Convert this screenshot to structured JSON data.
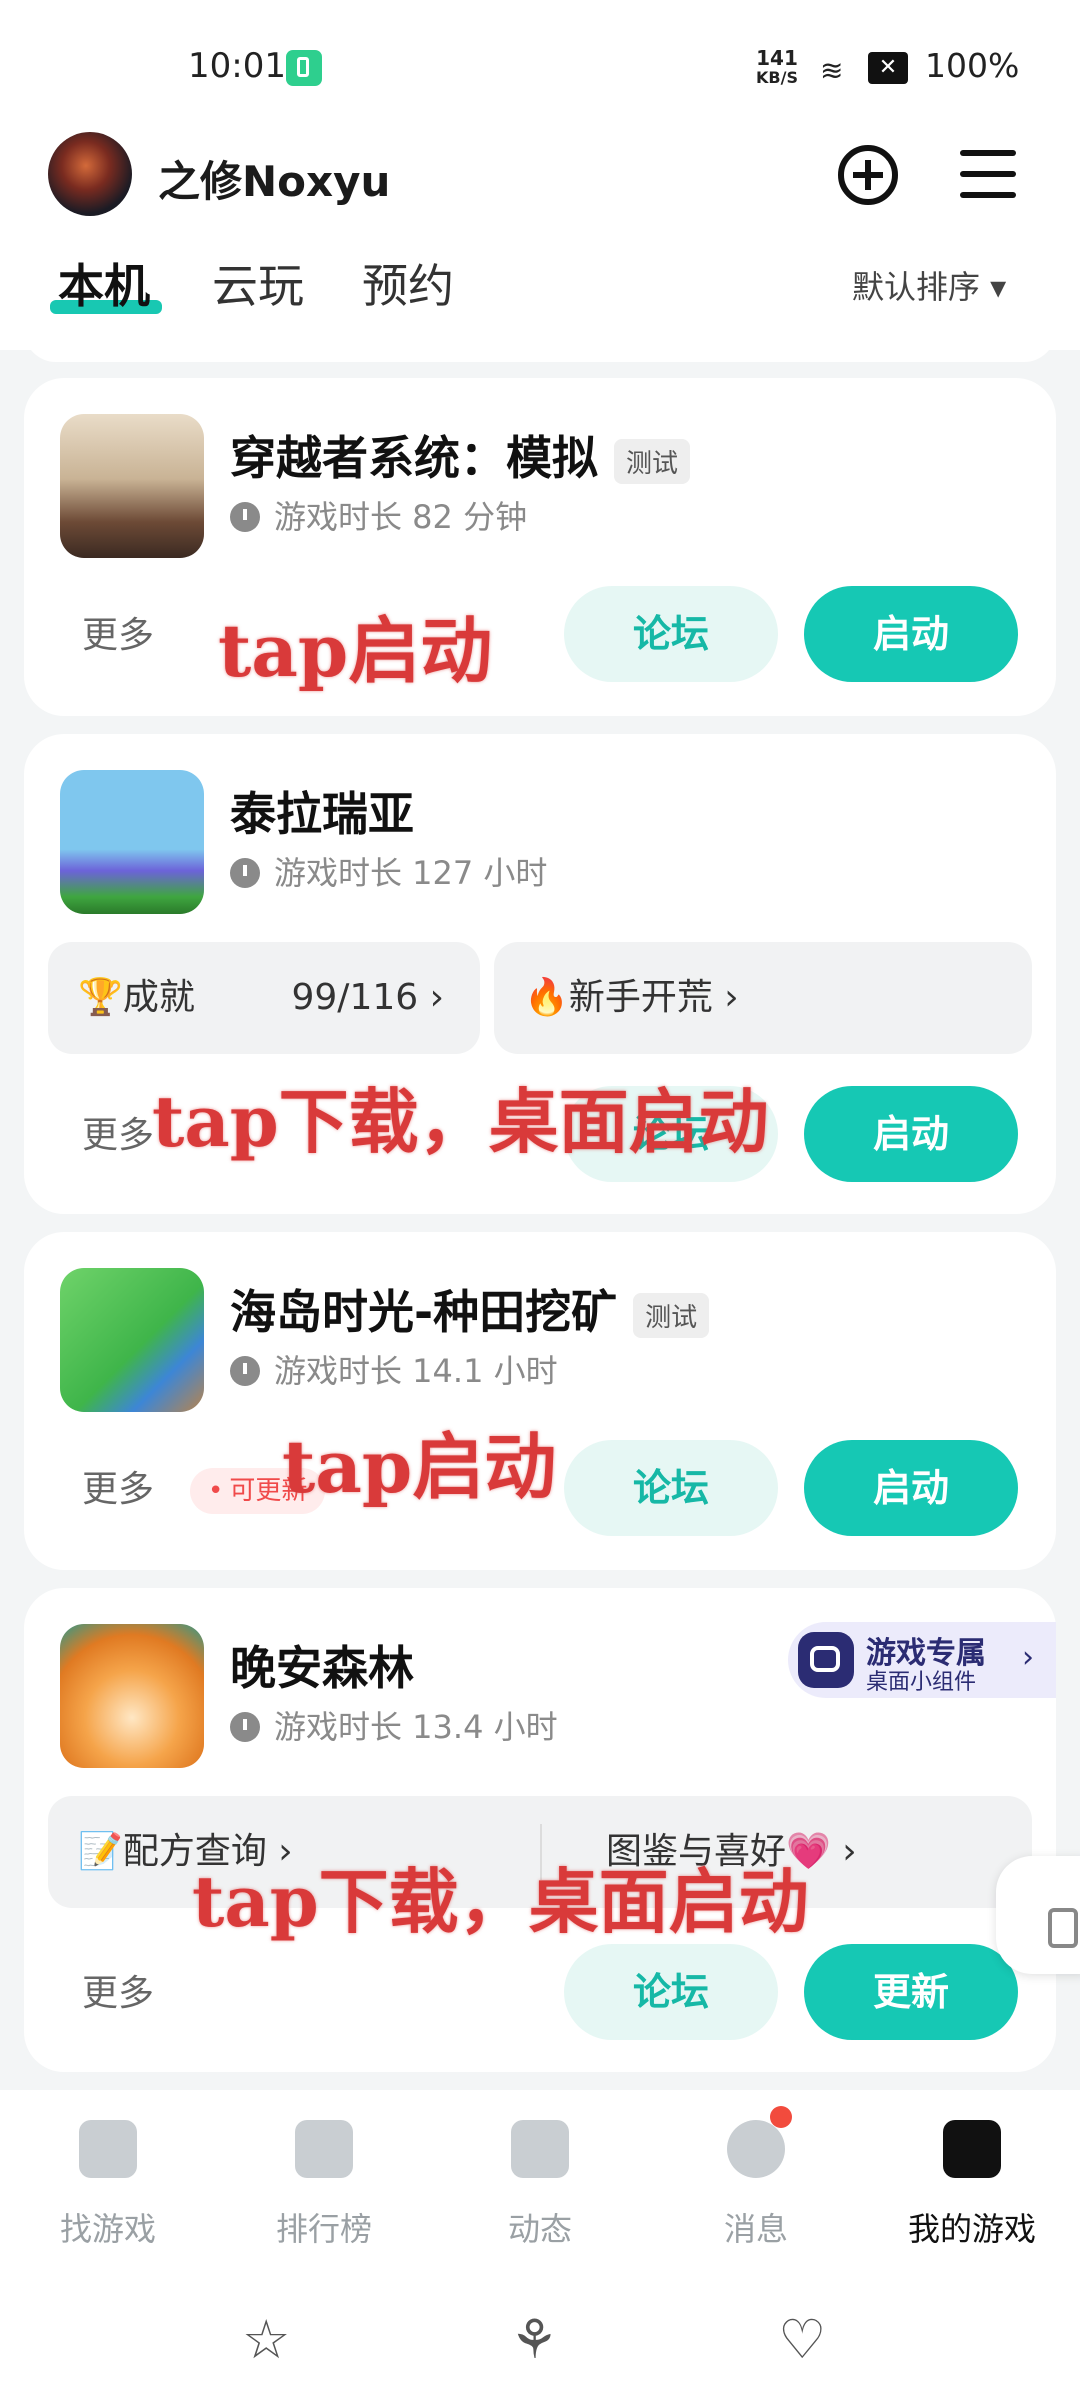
{
  "status_bar": {
    "time": "10:01",
    "net_speed_value": "141",
    "net_speed_unit": "KB/S",
    "battery": "100%"
  },
  "header": {
    "username": "之修Noxyu",
    "tabs": [
      "本机",
      "云玩",
      "预约"
    ],
    "active_tab": "本机",
    "sort_label": "默认排序 ▾"
  },
  "games": [
    {
      "title": "穿越者系统：模拟",
      "tag": "测试",
      "playtime": "游戏时长 82 分钟",
      "more_label": "更多",
      "forum_label": "论坛",
      "action_label": "启动"
    },
    {
      "title": "泰拉瑞亚",
      "playtime": "游戏时长 127 小时",
      "chips": [
        {
          "label": "🏆成就",
          "value": "99/116 ›"
        },
        {
          "label": "🔥新手开荒 ›",
          "value": ""
        }
      ],
      "more_label": "更多",
      "forum_label": "论坛",
      "action_label": "启动"
    },
    {
      "title": "海岛时光-种田挖矿",
      "tag": "测试",
      "playtime": "游戏时长 14.1 小时",
      "update_badge": "可更新",
      "more_label": "更多",
      "forum_label": "论坛",
      "action_label": "启动"
    },
    {
      "title": "晚安森林",
      "playtime": "游戏时长 13.4 小时",
      "widget_title": "游戏专属",
      "widget_subtitle": "桌面小组件",
      "chips": [
        {
          "label": "📝配方查询 ›",
          "value": ""
        },
        {
          "label": "图鉴与喜好💗 ›",
          "value": ""
        }
      ],
      "more_label": "更多",
      "forum_label": "论坛",
      "action_label": "更新"
    }
  ],
  "annotations": [
    "tap启动",
    "tap下载，桌面启动",
    "tap启动",
    "tap下载，桌面启动"
  ],
  "bottom_nav": {
    "items": [
      "找游戏",
      "排行榜",
      "动态",
      "消息",
      "我的游戏"
    ],
    "active": "我的游戏"
  },
  "system_nav": [
    "☆",
    "⚘",
    "♡"
  ],
  "colors": {
    "accent": "#16c8b4",
    "forum_bg": "#e6f7f4",
    "annotation": "#d93a3a",
    "badge_red": "#f24b3d"
  }
}
